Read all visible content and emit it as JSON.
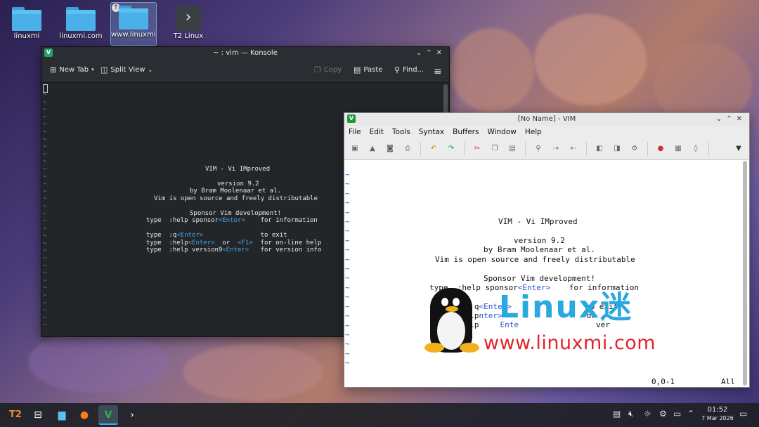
{
  "desktop": {
    "icons": [
      {
        "label": "linuxmi"
      },
      {
        "label": "linuxmi.com"
      },
      {
        "label": "www.linuxmi."
      },
      {
        "label": "T2 Linux"
      }
    ]
  },
  "konsole": {
    "title": "~ : vim — Konsole",
    "toolbar": {
      "new_tab": "New Tab",
      "split_view": "Split View",
      "copy": "Copy",
      "paste": "Paste",
      "find": "Find..."
    },
    "splash": {
      "line1": "VIM - Vi IMproved",
      "line2": "version 9.2",
      "line3": "by Bram Moolenaar et al.",
      "line4": "Vim is open source and freely distributable",
      "line5": "Sponsor Vim development!",
      "sponsor_type": "type  :help sponsor",
      "sponsor_enter": "<Enter>",
      "sponsor_info": "    for information",
      "q_type": "type  :q",
      "q_enter": "<Enter>",
      "q_info": "               to exit",
      "help_type": "type  :help",
      "help_enter": "<Enter>",
      "help_or": "  or  ",
      "help_f1": "<F1>",
      "help_info": "  for on-line help",
      "ver_type": "type  :help version9",
      "ver_enter": "<Enter>",
      "ver_info": "   for version info"
    }
  },
  "gvim": {
    "title": "[No Name] - VIM",
    "menu": [
      "File",
      "Edit",
      "Tools",
      "Syntax",
      "Buffers",
      "Window",
      "Help"
    ],
    "splash": {
      "line1": "VIM - Vi IMproved",
      "line2": "version 9.2",
      "line3": "by Bram Moolenaar et al.",
      "line4": "Vim is open source and freely distributable",
      "line5": "Sponsor Vim development!",
      "sponsor_type": "type  :help sponsor",
      "sponsor_enter": "<Enter>",
      "sponsor_info": "    for information",
      "q_type": "typ",
      "q_mid": "q",
      "q_enter": "<Enter>",
      "q_info": "to exit",
      "help_type": "t",
      "help_mid": "elp",
      "help_enter": "nter>",
      "help_info": "on",
      "ver_type": "t",
      "ver_mid": "elp",
      "ver_enter": "Ente",
      "ver_info": "ver"
    },
    "status": {
      "position": "0,0-1",
      "scroll": "All"
    }
  },
  "watermark": {
    "brand": "Linux迷",
    "url": "www.linuxmi.com"
  },
  "taskbar": {
    "clock_time": "01:52",
    "clock_date": "7 Mar 2026"
  }
}
